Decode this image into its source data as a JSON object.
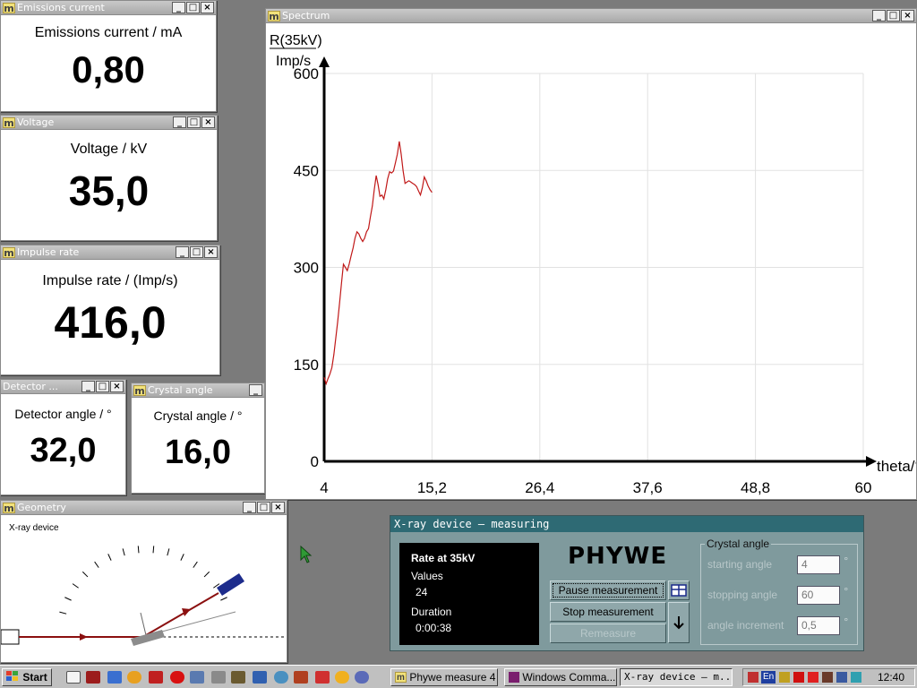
{
  "windows": {
    "emissions": {
      "title": "Emissions current",
      "label": "Emissions current / mA",
      "value": "0,80"
    },
    "voltage": {
      "title": "Voltage",
      "label": "Voltage / kV",
      "value": "35,0"
    },
    "impulse": {
      "title": "Impulse rate",
      "label": "Impulse rate / (Imp/s)",
      "value": "416,0"
    },
    "detector": {
      "title": "Detector ...",
      "label": "Detector angle / °",
      "value": "32,0"
    },
    "crystal": {
      "title": "Crystal angle",
      "label": "Crystal angle / °",
      "value": "16,0"
    },
    "geometry": {
      "title": "Geometry",
      "label": "X-ray device"
    },
    "spectrum": {
      "title": "Spectrum"
    }
  },
  "window_icon_letter": "m",
  "chart_data": {
    "type": "line",
    "ylabel_top": "R(35kV)",
    "ylabel_bottom": "Imp/s",
    "xlabel": "theta/°",
    "xlim": [
      4,
      60
    ],
    "ylim": [
      0,
      600
    ],
    "x_ticks": [
      "4",
      "15,2",
      "26,4",
      "37,6",
      "48,8",
      "60"
    ],
    "y_ticks": [
      "600",
      "450",
      "300",
      "150",
      "0"
    ],
    "grid": true,
    "line_color": "#c01818",
    "series": [
      {
        "x": [
          4.0,
          4.2,
          4.4,
          4.6,
          4.8,
          5.0,
          5.2,
          5.4,
          5.6,
          5.8,
          6.0,
          6.2,
          6.4,
          6.6,
          6.8,
          7.0,
          7.2,
          7.4,
          7.6,
          7.8,
          8.0,
          8.2,
          8.4,
          8.6,
          8.8,
          9.0,
          9.2,
          9.4,
          9.6,
          9.8,
          10.0,
          10.2,
          10.4,
          10.6,
          10.8,
          11.0,
          11.2,
          11.4,
          11.6,
          11.8,
          12.0,
          12.2,
          12.4,
          12.6,
          12.8,
          13.0,
          13.2,
          13.4,
          13.6,
          13.8,
          14.0,
          14.2,
          14.4,
          14.6,
          14.8,
          15.0,
          15.2
        ],
        "y": [
          130,
          120,
          128,
          135,
          145,
          165,
          190,
          215,
          245,
          275,
          305,
          300,
          295,
          305,
          318,
          330,
          345,
          355,
          352,
          345,
          340,
          345,
          355,
          360,
          378,
          395,
          420,
          442,
          428,
          410,
          412,
          406,
          420,
          437,
          448,
          446,
          449,
          462,
          475,
          495,
          475,
          450,
          430,
          432,
          434,
          432,
          430,
          428,
          425,
          418,
          412,
          423,
          440,
          434,
          426,
          420,
          416
        ]
      }
    ]
  },
  "dialog": {
    "title": "X-ray device – measuring",
    "rate_label": "Rate at 35kV",
    "values_label": "Values",
    "values_count": "24",
    "duration_label": "Duration",
    "duration_value": "0:00:38",
    "brand": "PHYWE",
    "pause_button": "Pause measurement",
    "stop_button": "Stop measurement",
    "remeasure_button": "Remeasure",
    "group_label": "Crystal angle",
    "starting_label": "starting angle",
    "starting_value": "4",
    "stopping_label": "stopping angle",
    "stopping_value": "60",
    "increment_label": "angle increment",
    "increment_value": "0,5",
    "degree_unit": "°"
  },
  "taskbar": {
    "start": "Start",
    "tasks": [
      "Phywe measure 4",
      "Windows Comma...",
      "X-ray device – m..."
    ],
    "lang": "En",
    "clock": "12:40"
  },
  "colors": {
    "desktop": "#7b7b7b",
    "titlebar": "#b5b5b5",
    "dialog_bg": "#7f9a9d",
    "dialog_title": "#2e6a74"
  }
}
